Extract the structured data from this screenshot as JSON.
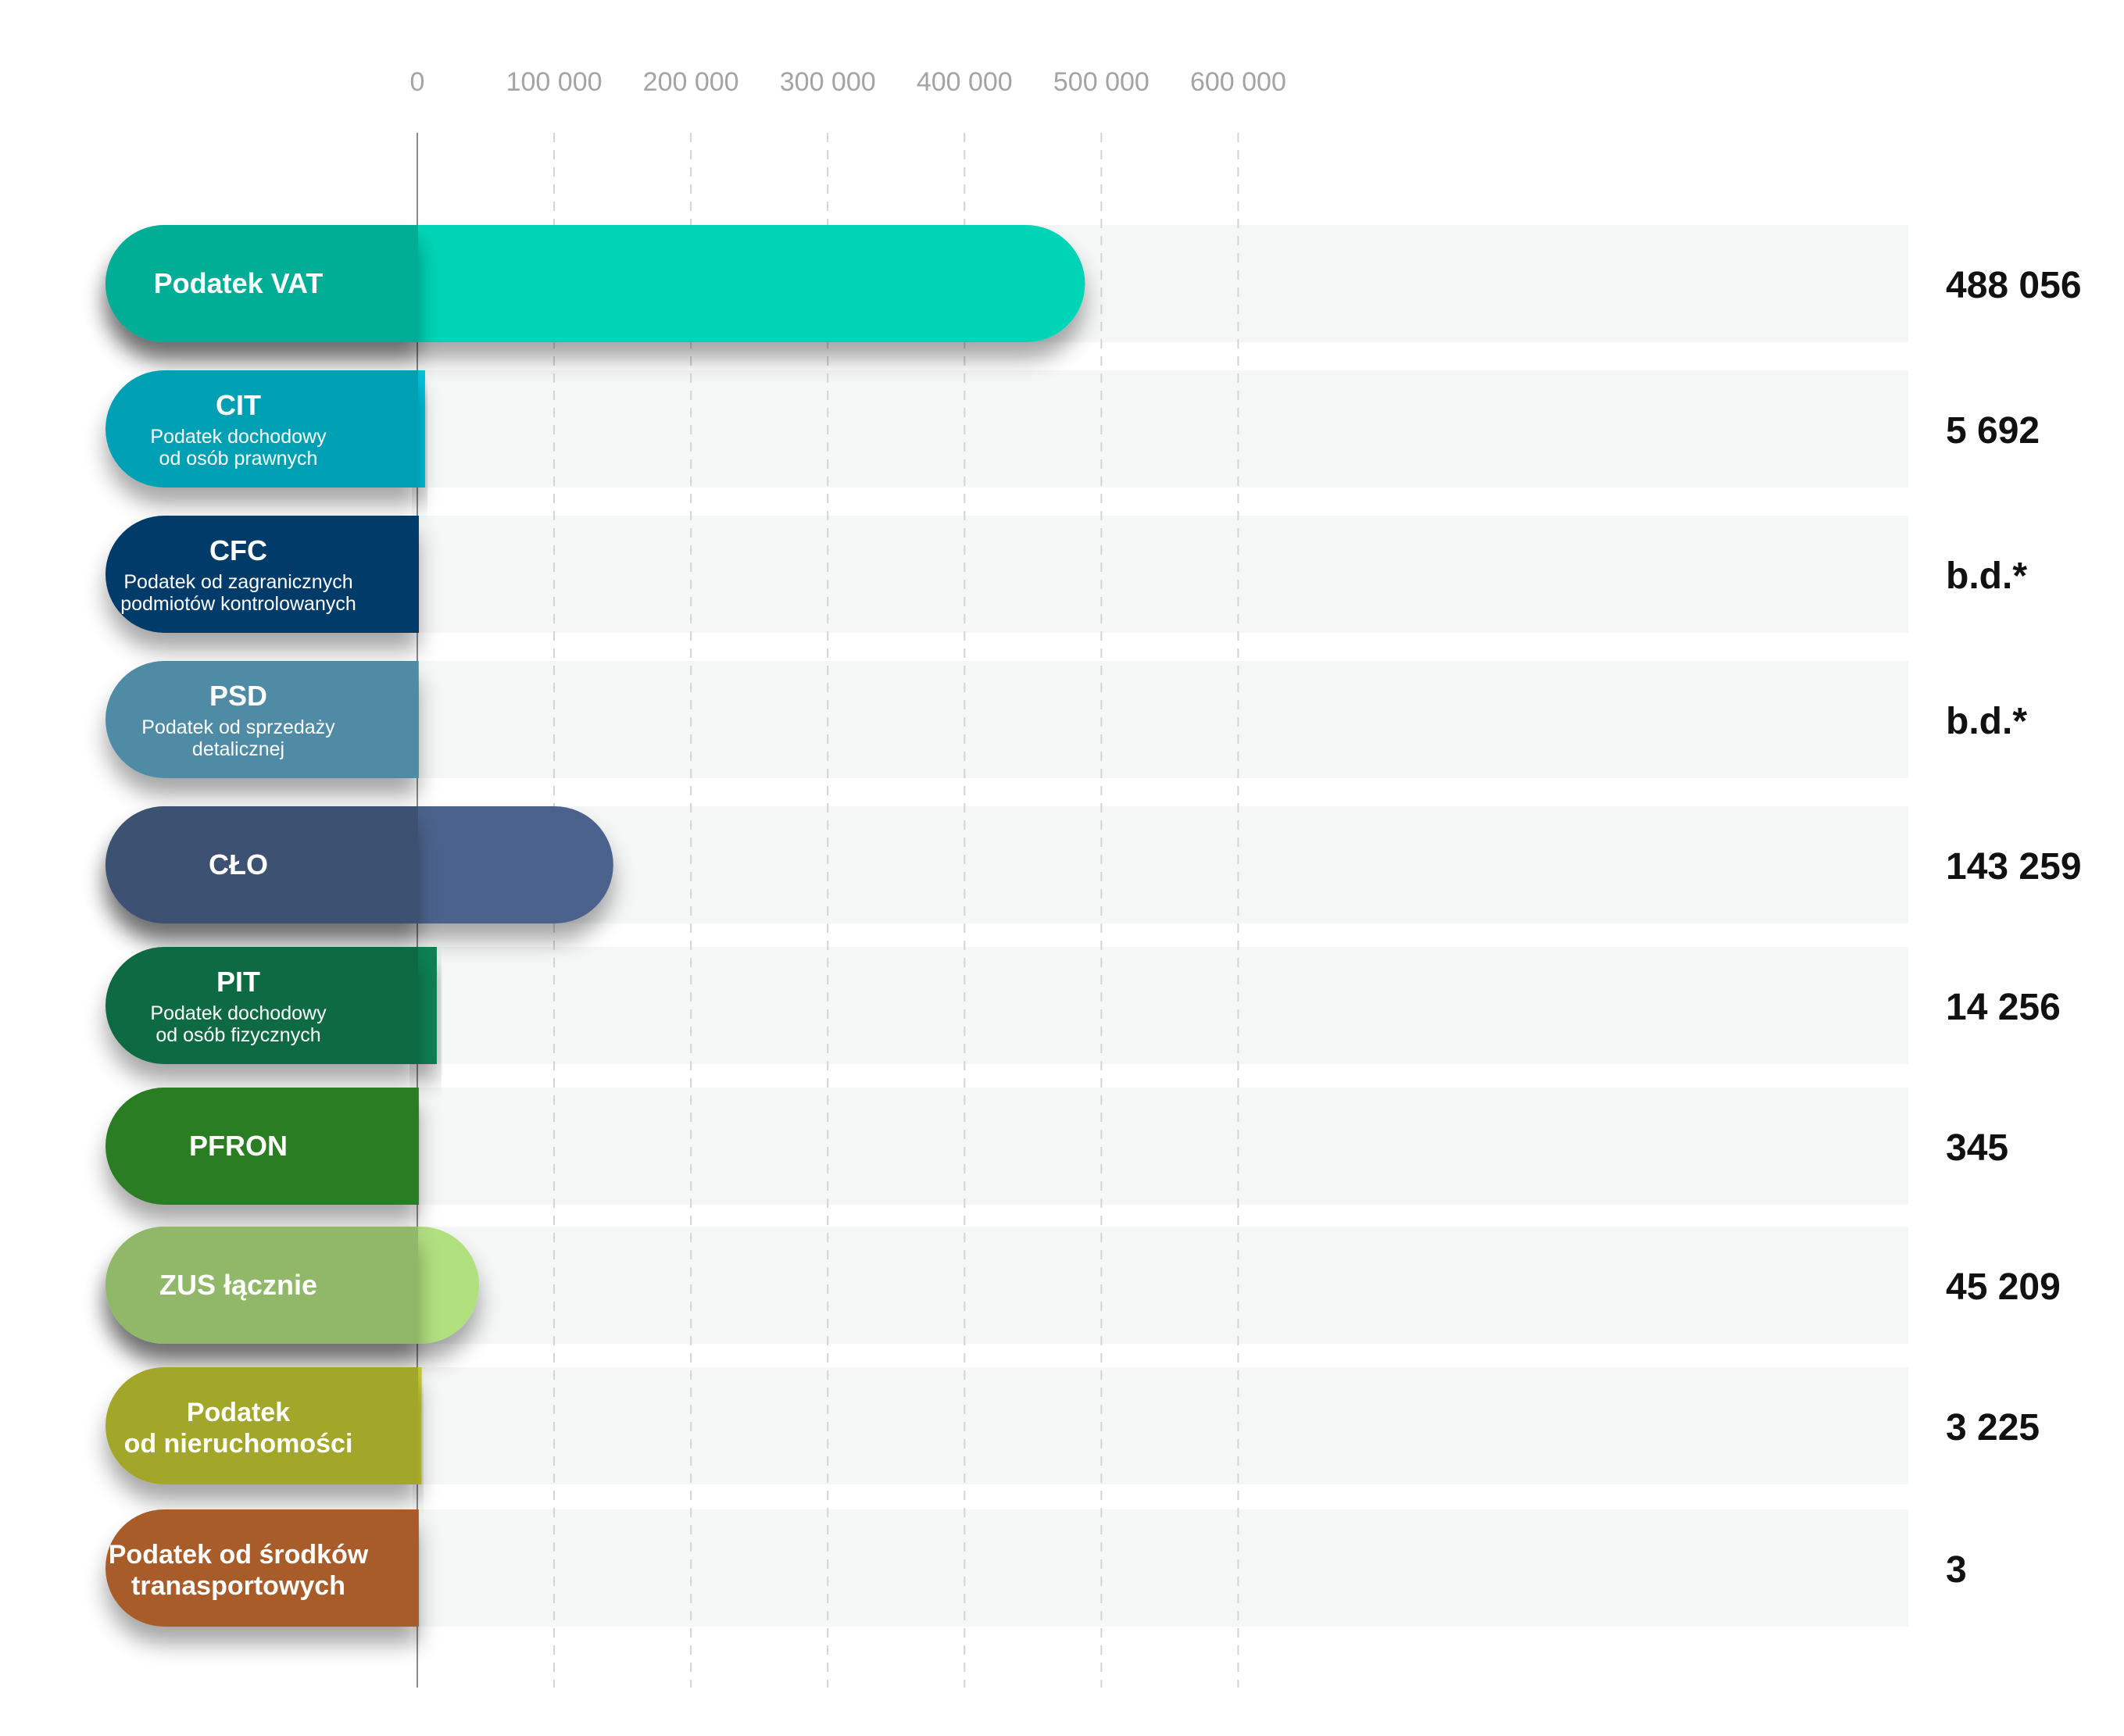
{
  "chart_data": {
    "type": "bar",
    "orientation": "horizontal",
    "x_ticks": [
      "0",
      "100 000",
      "200 000",
      "300 000",
      "400 000",
      "500 000",
      "600 000"
    ],
    "xlim": [
      0,
      650000
    ],
    "grid": "vertical dashed",
    "categories": [
      {
        "title": "Podatek VAT",
        "subtitle": [],
        "value": 488056,
        "value_label": "488 056",
        "color": "#00d4b6"
      },
      {
        "title": "CIT",
        "subtitle": [
          "Podatek dochodowy",
          "od osób prawnych"
        ],
        "value": 5692,
        "value_label": "5 692",
        "color": "#00c3dc"
      },
      {
        "title": "CFC",
        "subtitle": [
          "Podatek od zagranicznych",
          "podmiotów kontrolowanych"
        ],
        "value": null,
        "value_label": "b.d.*",
        "color": "#004781"
      },
      {
        "title": "PSD",
        "subtitle": [
          "Podatek od sprzedaży",
          "detalicznej"
        ],
        "value": null,
        "value_label": "b.d.*",
        "color": "#62a9c8"
      },
      {
        "title": "CŁO",
        "subtitle": [],
        "value": 143259,
        "value_label": "143 259",
        "color": "#4b638c"
      },
      {
        "title": "PIT",
        "subtitle": [
          "Podatek dochodowy",
          "od osób fizycznych"
        ],
        "value": 14256,
        "value_label": "14 256",
        "color": "#0c8152"
      },
      {
        "title": "PFRON",
        "subtitle": [],
        "value": 345,
        "value_label": "345",
        "color": "#33992b"
      },
      {
        "title": "ZUS łącznie",
        "subtitle": [],
        "value": 45209,
        "value_label": "45 209",
        "color": "#b1e07e"
      },
      {
        "title": "Podatek",
        "title2": "od nieruchomości",
        "subtitle": [],
        "value": 3225,
        "value_label": "3 225",
        "color": "#c6cc33"
      },
      {
        "title": "Podatek od środków",
        "title2": "tranasportowych",
        "subtitle": [],
        "value": 3,
        "value_label": "3",
        "color": "#cd7034"
      }
    ]
  }
}
